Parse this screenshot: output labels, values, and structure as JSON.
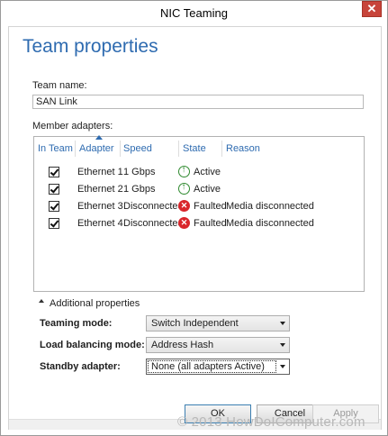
{
  "window": {
    "title": "NIC Teaming",
    "close_glyph": "✕",
    "close_icon": "close-icon"
  },
  "page": {
    "heading": "Team properties"
  },
  "team_name": {
    "label": "Team name:",
    "value": "SAN Link"
  },
  "members": {
    "label": "Member adapters:",
    "columns": [
      "In Team",
      "Adapter",
      "Speed",
      "State",
      "Reason"
    ],
    "sorted_column": "Adapter",
    "rows": [
      {
        "in_team": true,
        "adapter": "Ethernet 1",
        "speed": "1 Gbps",
        "state_icon": "active-up-arrow-icon",
        "state": "Active",
        "reason": ""
      },
      {
        "in_team": true,
        "adapter": "Ethernet 2",
        "speed": "1 Gbps",
        "state_icon": "active-up-arrow-icon",
        "state": "Active",
        "reason": ""
      },
      {
        "in_team": true,
        "adapter": "Ethernet 3",
        "speed": "Disconnected",
        "state_icon": "faulted-error-icon",
        "state": "Faulted",
        "reason": "Media disconnected"
      },
      {
        "in_team": true,
        "adapter": "Ethernet 4",
        "speed": "Disconnected",
        "state_icon": "faulted-error-icon",
        "state": "Faulted",
        "reason": "Media disconnected"
      }
    ]
  },
  "additional": {
    "toggle_label": "Additional properties",
    "teaming_mode": {
      "label": "Teaming mode:",
      "value": "Switch Independent"
    },
    "load_balancing_mode": {
      "label": "Load balancing mode:",
      "value": "Address Hash"
    },
    "standby_adapter": {
      "label": "Standby adapter:",
      "value": "None (all adapters Active)"
    }
  },
  "buttons": {
    "ok": "OK",
    "cancel": "Cancel",
    "apply": "Apply"
  },
  "watermark": "© 2013 HowDoIComputer.com",
  "colors": {
    "accent": "#2e6bb0",
    "active": "#2f8a2f",
    "faulted": "#d9262b",
    "close": "#c7443a"
  }
}
